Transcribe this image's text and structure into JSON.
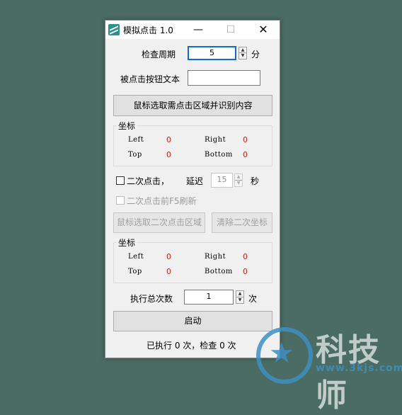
{
  "window": {
    "title": "模拟点击 1.0",
    "min_glyph": "—",
    "max_glyph": "☐",
    "close_glyph": "✕"
  },
  "period": {
    "label": "检查周期",
    "value": "5",
    "unit": "分"
  },
  "button_text": {
    "label": "被点击按钮文本",
    "value": ""
  },
  "select_area_button": "鼠标选取需点击区域并识别内容",
  "coords1": {
    "title": "坐标",
    "left_label": "Left",
    "left_value": "0",
    "right_label": "Right",
    "right_value": "0",
    "top_label": "Top",
    "top_value": "0",
    "bottom_label": "Bottom",
    "bottom_value": "0"
  },
  "second_click": {
    "label": "二次点击，",
    "delay_label": "延迟",
    "delay_value": "15",
    "delay_unit": "秒",
    "checked": false
  },
  "f5_refresh": {
    "label": "二次点击前F5刷新",
    "enabled": false
  },
  "select_second_button": "鼠标选取二次点击区域",
  "clear_second_button": "清除二次坐标",
  "coords2": {
    "title": "坐标",
    "left_label": "Left",
    "left_value": "0",
    "right_label": "Right",
    "right_value": "0",
    "top_label": "Top",
    "top_value": "0",
    "bottom_label": "Bottom",
    "bottom_value": "0"
  },
  "total": {
    "label": "执行总次数",
    "value": "1",
    "unit": "次"
  },
  "start_button": "启动",
  "status": "已执行 0 次，检查 0 次",
  "watermark": {
    "brand": "科技师",
    "url": "www.3kjs.com"
  },
  "colors": {
    "background": "#4b6c62",
    "window": "#f0f0f0",
    "value_red": "#c0271a",
    "focus_border": "#0f6bd0"
  }
}
